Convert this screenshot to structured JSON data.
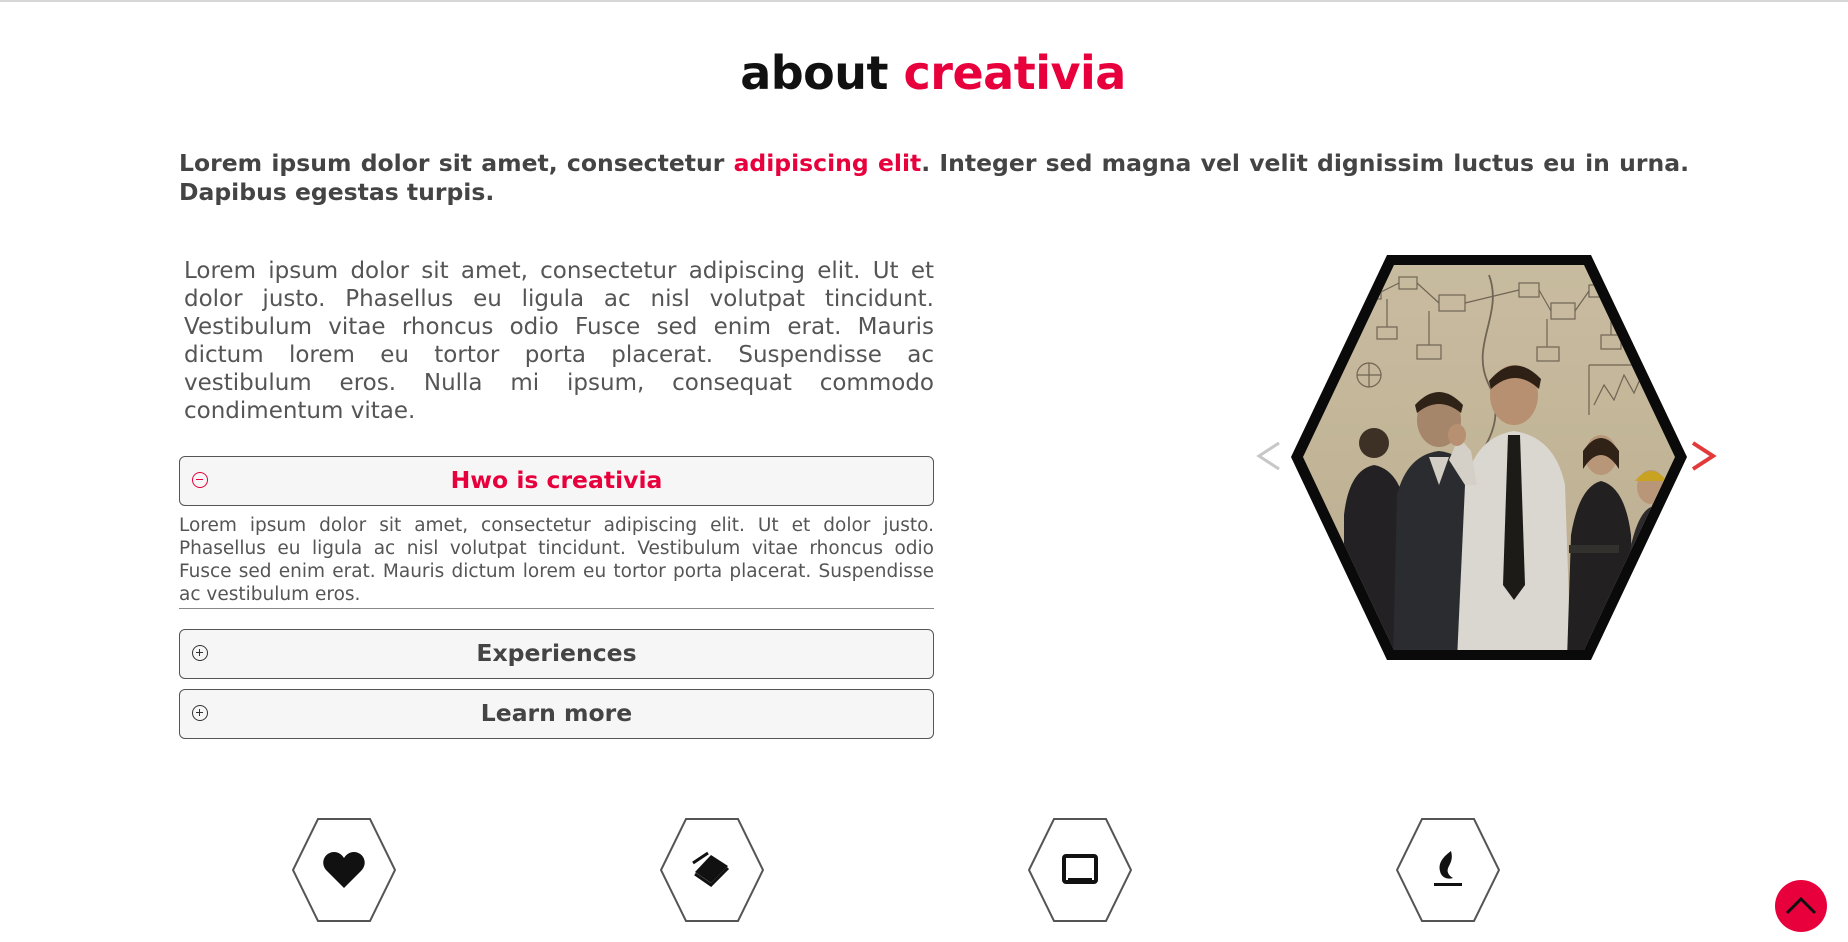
{
  "header": {
    "title_main": "about",
    "title_accent": "creativia"
  },
  "lead": {
    "part1": "Lorem ipsum dolor sit amet, consectetur ",
    "highlight": "adipiscing elit",
    "part2": ". Integer sed magna vel velit dignissim luctus eu in urna. Dapibus egestas turpis."
  },
  "intro": {
    "text": "Lorem ipsum dolor sit amet, consectetur adipiscing elit. Ut et dolor justo. Phasellus eu ligula ac nisl volutpat tincidunt. Vestibulum vitae rhoncus odio Fusce sed enim erat. Mauris dictum lorem eu tortor porta placerat. Suspendisse ac vestibulum eros. Nulla mi ipsum, consequat commodo condimentum vitae."
  },
  "accordion": [
    {
      "title": "Hwo is creativia",
      "expanded": true,
      "icon": "minus-circle-icon",
      "body": "Lorem ipsum dolor sit amet, consectetur adipiscing elit. Ut et dolor justo. Phasellus eu ligula ac nisl volutpat tincidunt. Vestibulum vitae rhoncus odio Fusce sed enim erat. Mauris dictum lorem eu tortor porta placerat. Suspendisse ac vestibulum eros."
    },
    {
      "title": "Experiences",
      "expanded": false,
      "icon": "plus-circle-icon"
    },
    {
      "title": "Learn more",
      "expanded": false,
      "icon": "plus-circle-icon"
    }
  ],
  "slider": {
    "prev_icon": "chevron-left-icon",
    "next_icon": "chevron-right-icon",
    "image": "business-team-whiteboard-photo"
  },
  "features": [
    {
      "icon": "heart-icon"
    },
    {
      "icon": "layers-icon"
    },
    {
      "icon": "tablet-icon"
    },
    {
      "icon": "flame-icon"
    }
  ],
  "back_to_top": {
    "icon": "chevron-up-icon"
  },
  "colors": {
    "accent": "#e8003d",
    "text": "#444444",
    "panel": "#f6f6f6",
    "border": "#555555"
  }
}
